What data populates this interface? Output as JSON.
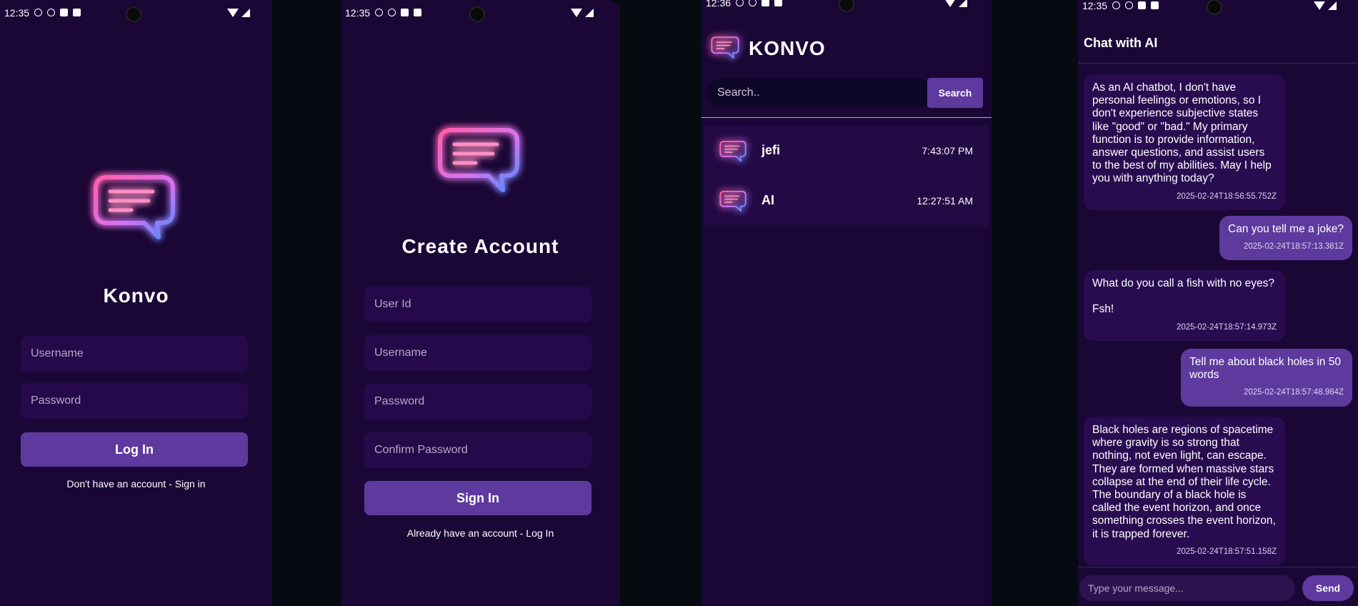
{
  "colors": {
    "background": "#1b0736",
    "accent": "#5e3a9e",
    "input": "#25094a",
    "outer": "#050b10"
  },
  "status_bar": {
    "time": "12:35",
    "time_partial": "12:36"
  },
  "login": {
    "app_name": "Konvo",
    "username_placeholder": "Username",
    "password_placeholder": "Password",
    "login_button": "Log In",
    "signup_link": "Don't have an account - Sign in"
  },
  "signup": {
    "title": "Create Account",
    "userid_placeholder": "User Id",
    "username_placeholder": "Username",
    "password_placeholder": "Password",
    "confirm_placeholder": "Confirm Password",
    "signin_button": "Sign In",
    "login_link": "Already have an account - Log In"
  },
  "contacts_screen": {
    "app_title": "KONVO",
    "search_placeholder": "Search..",
    "search_button": "Search",
    "contacts": [
      {
        "name": "jefi",
        "time": "7:43:07 PM",
        "icon": "chat-bubble-icon"
      },
      {
        "name": "AI",
        "time": "12:27:51 AM",
        "icon": "chat-bubble-icon"
      }
    ]
  },
  "chat": {
    "title": "Chat with AI",
    "messages": [
      {
        "sender": "ai",
        "text": "As an AI chatbot, I don't have personal feelings or emotions, so I don't experience subjective states like \"good\" or \"bad.\" My primary function is to provide information, answer questions, and assist users to the best of my abilities. May I help you with anything today?",
        "timestamp": "2025-02-24T18:56:55.752Z"
      },
      {
        "sender": "me",
        "text": "Can you tell me a joke?",
        "timestamp": "2025-02-24T18:57:13.381Z"
      },
      {
        "sender": "ai",
        "text": "What do you call a fish with no eyes?\n\nFsh!",
        "timestamp": "2025-02-24T18:57:14.973Z"
      },
      {
        "sender": "me",
        "text": "Tell me about black holes in 50 words",
        "timestamp": "2025-02-24T18:57:48.984Z"
      },
      {
        "sender": "ai",
        "text": "Black holes are regions of spacetime where gravity is so strong that nothing, not even light, can escape. They are formed when massive stars collapse at the end of their life cycle. The boundary of a black hole is called the event horizon, and once something crosses the event horizon, it is trapped forever.",
        "timestamp": "2025-02-24T18:57:51.158Z"
      }
    ],
    "input_placeholder": "Type your message...",
    "send_button": "Send"
  }
}
